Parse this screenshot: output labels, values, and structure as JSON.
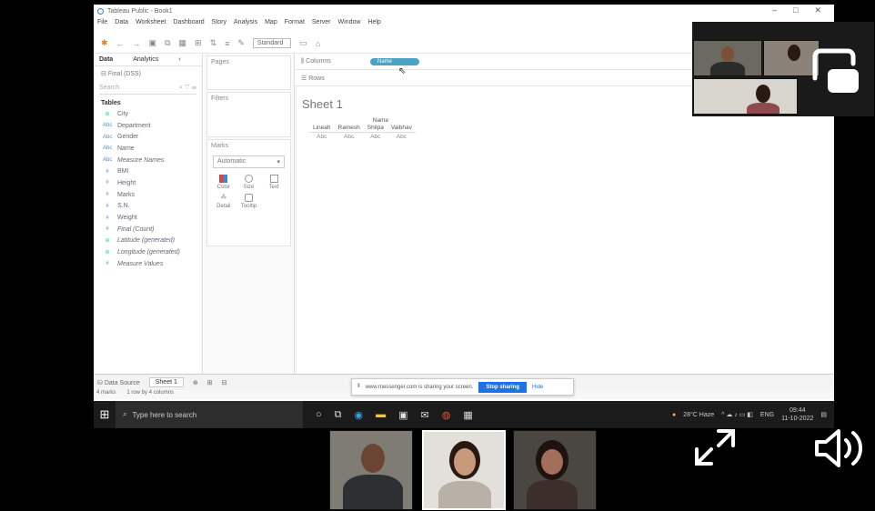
{
  "window": {
    "title": "Tableau Public - Book1",
    "controls": [
      "–",
      "□",
      "✕"
    ]
  },
  "menu": [
    "File",
    "Data",
    "Worksheet",
    "Dashboard",
    "Story",
    "Analysis",
    "Map",
    "Format",
    "Server",
    "Window",
    "Help"
  ],
  "toolbar": {
    "fit_select": "Standard"
  },
  "data_pane": {
    "tab_data": "Data",
    "tab_analytics": "Analytics",
    "source": "Final (DSS)",
    "search_placeholder": "Search",
    "tables_label": "Tables",
    "fields": [
      {
        "type": "geo",
        "name": "City"
      },
      {
        "type": "abc",
        "name": "Department"
      },
      {
        "type": "abc",
        "name": "Gender"
      },
      {
        "type": "abc",
        "name": "Name"
      },
      {
        "type": "abc",
        "name": "Measure Names",
        "italic": true
      },
      {
        "type": "num",
        "name": "BMI"
      },
      {
        "type": "num",
        "name": "Height"
      },
      {
        "type": "num",
        "name": "Marks"
      },
      {
        "type": "num",
        "name": "S.N."
      },
      {
        "type": "num",
        "name": "Weight"
      },
      {
        "type": "num",
        "name": "Final (Count)",
        "italic": true
      },
      {
        "type": "geo",
        "name": "Latitude (generated)",
        "italic": true
      },
      {
        "type": "geo",
        "name": "Longitude (generated)",
        "italic": true
      },
      {
        "type": "num",
        "name": "Measure Values",
        "italic": true
      }
    ]
  },
  "cards": {
    "pages": "Pages",
    "filters": "Filters",
    "marks": "Marks",
    "marks_type": "Automatic",
    "marks_buttons": [
      "Color",
      "Size",
      "Text",
      "Detail",
      "Tooltip"
    ]
  },
  "shelves": {
    "columns": "Columns",
    "rows": "Rows",
    "column_pill": "Name"
  },
  "sheet": {
    "title": "Sheet 1",
    "header": "Name",
    "names": [
      "Lineah",
      "Ramesh",
      "Shilpa",
      "Vaibhav"
    ],
    "cell_value": "Abc"
  },
  "sheet_tabs": {
    "data_source": "Data Source",
    "sheet1": "Sheet 1"
  },
  "status": {
    "marks": "4 marks",
    "layout": "1 row by 4 columns"
  },
  "share_bar": {
    "message": "www.messenger.com is sharing your screen.",
    "stop": "Stop sharing",
    "hide": "Hide"
  },
  "taskbar": {
    "search_placeholder": "Type here to search",
    "weather": "28°C Haze",
    "lang": "ENG",
    "time": "09:44",
    "date": "11-10-2022"
  },
  "colors": {
    "accent": "#4ba3c3",
    "share_button": "#1a73e8",
    "taskbar": "#1b1b1b"
  }
}
